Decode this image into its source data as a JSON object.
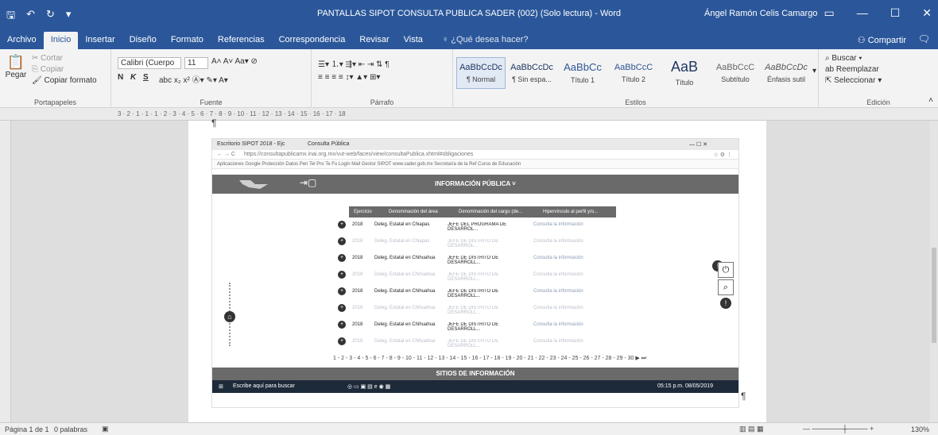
{
  "titlebar": {
    "title": "PANTALLAS SIPOT CONSULTA PUBLICA SADER (002) (Solo lectura) - Word",
    "user": "Ángel Ramón Celis Camargo",
    "qat_icons": [
      "save-icon",
      "undo-icon",
      "redo-icon",
      "customize-icon"
    ]
  },
  "tabs": [
    {
      "label": "Archivo"
    },
    {
      "label": "Inicio"
    },
    {
      "label": "Insertar"
    },
    {
      "label": "Diseño"
    },
    {
      "label": "Formato"
    },
    {
      "label": "Referencias"
    },
    {
      "label": "Correspondencia"
    },
    {
      "label": "Revisar"
    },
    {
      "label": "Vista"
    }
  ],
  "tell_me": "¿Qué desea hacer?",
  "share": "Compartir",
  "clipboard": {
    "paste": "Pegar",
    "cut": "Cortar",
    "copy": "Copiar",
    "format_painter": "Copiar formato",
    "label": "Portapapeles"
  },
  "font": {
    "name": "Calibri (Cuerpo",
    "size": "11",
    "bold": "N",
    "italic": "K",
    "underline": "S",
    "label": "Fuente"
  },
  "paragraph": {
    "label": "Párrafo"
  },
  "styles": {
    "label": "Estilos",
    "items": [
      {
        "preview": "AaBbCcDc",
        "name": "¶ Normal"
      },
      {
        "preview": "AaBbCcDc",
        "name": "¶ Sin espa..."
      },
      {
        "preview": "AaBbCc",
        "name": "Título 1"
      },
      {
        "preview": "AaBbCcC",
        "name": "Título 2"
      },
      {
        "preview": "AaB",
        "name": "Título"
      },
      {
        "preview": "AaBbCcC",
        "name": "Subtítulo"
      },
      {
        "preview": "AaBbCcDc",
        "name": "Énfasis sutil"
      }
    ]
  },
  "editing": {
    "find": "Buscar",
    "replace": "Reemplazar",
    "select": "Seleccionar",
    "label": "Edición"
  },
  "ruler_marks": "3 · 2 · 1 · 1 · 1 · 2 · 3 · 4 · 5 · 6 · 7 · 8 · 9 · 10 · 11 · 12 · 13 · 14 · 15 · 16 · 17 · 18",
  "status": {
    "page": "Página 1 de 1",
    "words": "0 palabras",
    "zoom": "130%"
  },
  "screenshot": {
    "tab1": "Escritorio SIPOT 2018 - Ejc",
    "tab2": "Consulta Pública",
    "url": "https://consultapublicamx.inai.org.mx/vut-web/faces/view/consultaPublica.xhtml#obligaciones",
    "bookmarks": "Aplicaciones  Google  Protección Datos  Pen Tel Pro Te Fu  Login Mail  Gestor SIPOT  www.sader.gob.mx  Secretaría de la Ref  Curso de Educación",
    "header": "INFORMACIÓN PÚBLICA",
    "columns": [
      "Ejercicio",
      "Denominación del área",
      "Denominación del cargo (de...",
      "Hipervínculo al perfil y/o..."
    ],
    "rows": [
      {
        "year": "2018",
        "area": "Deleg. Estatal en Chiapas",
        "cargo": "JEFE DEL PROGRAMA DE DESARROL...",
        "link": "Consulta la información",
        "faded": false
      },
      {
        "year": "2018",
        "area": "Deleg. Estatal en Chiapas",
        "cargo": "JEFE DE DISTRITO DE DESARROL...",
        "link": "Consulta la información",
        "faded": true
      },
      {
        "year": "2018",
        "area": "Deleg. Estatal en Chihuahua",
        "cargo": "JEFE DE DISTRITO DE DESARROLL...",
        "link": "Consulta la información",
        "faded": false
      },
      {
        "year": "2018",
        "area": "Deleg. Estatal en Chihuahua",
        "cargo": "JEFE DE DISTRITO DE DESARROLL...",
        "link": "Consulta la información",
        "faded": true
      },
      {
        "year": "2018",
        "area": "Deleg. Estatal en Chihuahua",
        "cargo": "JEFE DE DISTRITO DE DESARROLL...",
        "link": "Consulta la información",
        "faded": false
      },
      {
        "year": "2018",
        "area": "Deleg. Estatal en Chihuahua",
        "cargo": "JEFE DE DISTRITO DE DESARROLL...",
        "link": "Consulta la información",
        "faded": true
      },
      {
        "year": "2018",
        "area": "Deleg. Estatal en Chihuahua",
        "cargo": "JEFE DE DISTRITO DE DESARROLL...",
        "link": "Consulta la información",
        "faded": false
      },
      {
        "year": "2018",
        "area": "Deleg. Estatal en Chihuahua",
        "cargo": "JEFE DE DISTRITO DE DESARROLL...",
        "link": "Consulta la información",
        "faded": true
      }
    ],
    "pager": "1 - 2 - 3 - 4 - 5 - 6 - 7 - 8 - 9 - 10 - 11 - 12 - 13 - 14 - 15 - 16 - 17 - 18 - 19 - 20 - 21 - 22 - 23 - 24 - 25 - 26 - 27 - 28 - 29 - 30 ▶ ⏭",
    "footer": "SITIOS DE INFORMACIÓN",
    "taskbar_search": "Escribe aquí para buscar",
    "clock": "05:15 p.m. 08/05/2019"
  }
}
